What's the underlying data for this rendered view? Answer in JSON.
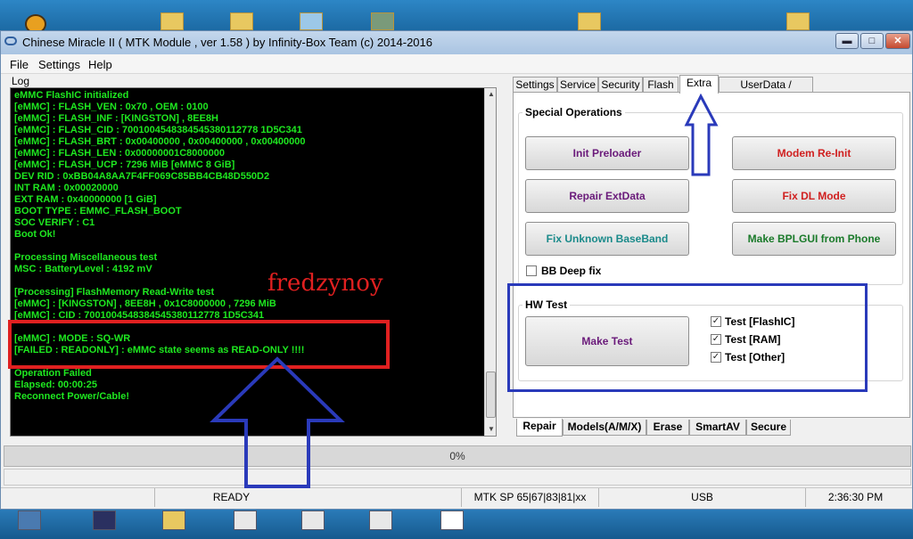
{
  "window": {
    "title": "Chinese Miracle II ( MTK Module , ver 1.58 ) by Infinity-Box Team (c) 2014-2016",
    "minimize": "▬",
    "maximize": "□",
    "close": "✕"
  },
  "menu": [
    "File",
    "Settings",
    "Help"
  ],
  "log": {
    "label": "Log",
    "lines": [
      "eMMC FlashIC initialized",
      "[eMMC] : FLASH_VEN : 0x70 , OEM : 0100",
      "[eMMC] : FLASH_INF : [KINGSTON] , 8EE8H",
      "[eMMC] : FLASH_CID : 7001004548384545380112778 1D5C341",
      "[eMMC] : FLASH_BRT : 0x00400000 , 0x00400000 , 0x00400000",
      "[eMMC] : FLASH_LEN : 0x00000001C8000000",
      "[eMMC] : FLASH_UCP : 7296 MiB [eMMC 8 GiB]",
      "DEV RID     : 0xBB04A8AA7F4FF069C85BB4CB48D550D2",
      "INT RAM     : 0x00020000",
      "EXT RAM     : 0x40000000 [1 GiB]",
      "BOOT TYPE : EMMC_FLASH_BOOT",
      "SOC VERIFY : C1",
      "Boot Ok!",
      "",
      "Processing Miscellaneous test",
      "MSC : BatteryLevel : 4192 mV",
      "",
      "[Processing] FlashMemory Read-Write test",
      "[eMMC] : [KINGSTON] , 8EE8H , 0x1C8000000 , 7296 MiB",
      "[eMMC] : CID : 7001004548384545380112778 1D5C341",
      "",
      "[eMMC] : MODE : SQ-WR",
      "[FAILED : READONLY] : eMMC state seems as READ-ONLY !!!!",
      "",
      "Operation Failed",
      "Elapsed: 00:00:25",
      "Reconnect Power/Cable!"
    ],
    "watermark": "fredzynoy"
  },
  "top_tabs": [
    "Settings",
    "Service",
    "Security",
    "Flash",
    "Extra",
    "UserData / Forensic"
  ],
  "special_operations": {
    "title": "Special Operations",
    "buttons": [
      "Init Preloader",
      "Modem Re-Init",
      "Repair ExtData",
      "Fix DL Mode",
      "Fix Unknown BaseBand",
      "Make BPLGUI from Phone"
    ],
    "bb_deep_fix": "BB Deep fix"
  },
  "hw_test": {
    "title": "HW Test",
    "button": "Make Test",
    "checks": [
      "Test [FlashIC]",
      "Test [RAM]",
      "Test [Other]"
    ]
  },
  "bottom_tabs": [
    "Repair",
    "Models(A/M/X)",
    "Erase",
    "SmartAV",
    "Secure"
  ],
  "progress": {
    "percent": 0,
    "label": "0%"
  },
  "status": {
    "state": "READY",
    "platform": "MTK SP 65|67|83|81|xx",
    "port": "USB",
    "time": "2:36:30 PM"
  },
  "colors": {
    "log_text": "#1ee820",
    "annotation_red": "#e02020",
    "annotation_blue": "#2a3aba"
  }
}
